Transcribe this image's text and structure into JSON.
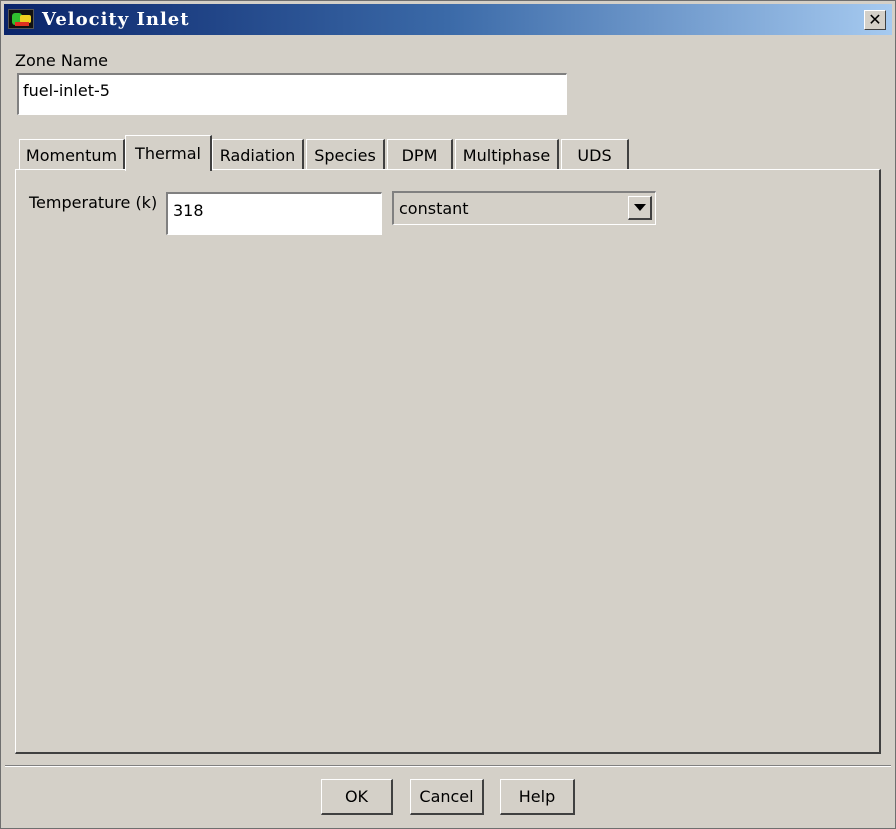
{
  "window": {
    "title": "Velocity Inlet",
    "close_glyph": "✕"
  },
  "zone": {
    "label": "Zone Name",
    "value": "fuel-inlet-5"
  },
  "tabs": [
    {
      "label": "Momentum",
      "active": false
    },
    {
      "label": "Thermal",
      "active": true
    },
    {
      "label": "Radiation",
      "active": false
    },
    {
      "label": "Species",
      "active": false
    },
    {
      "label": "DPM",
      "active": false
    },
    {
      "label": "Multiphase",
      "active": false
    },
    {
      "label": "UDS",
      "active": false
    }
  ],
  "thermal": {
    "temperature_label": "Temperature (k)",
    "temperature_value": "318",
    "method_value": "constant"
  },
  "buttons": {
    "ok": "OK",
    "cancel": "Cancel",
    "help": "Help"
  },
  "colors": {
    "title_gradient_start": "#0a246a",
    "title_gradient_end": "#a6caf0",
    "face": "#d4d0c8"
  }
}
